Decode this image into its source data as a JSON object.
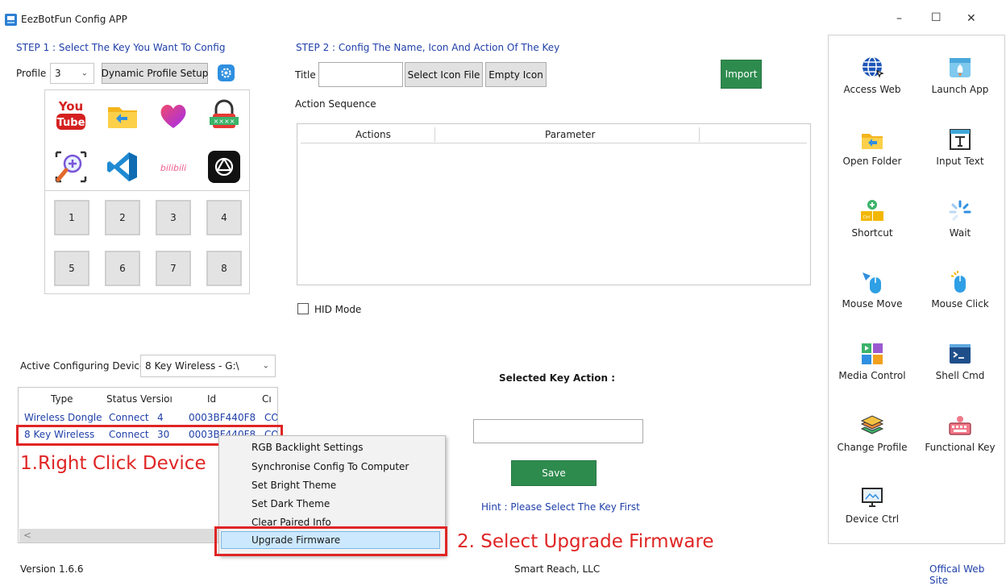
{
  "window": {
    "title": "EezBotFun Config APP",
    "controls": {
      "minimize": "–",
      "maximize": "☐",
      "close": "✕"
    }
  },
  "step1": {
    "title": "STEP 1 : Select The Key You Want To Config",
    "profile_label": "Profile",
    "profile_value": "3",
    "dynamic_button": "Dynamic Profile Setup",
    "app_keys": [
      {
        "icon": "youtube-icon",
        "youtube_text_top": "You",
        "youtube_text_bottom": "Tube"
      },
      {
        "icon": "folder-icon"
      },
      {
        "icon": "heart-icon"
      },
      {
        "icon": "password-lock-icon"
      },
      {
        "icon": "magnifier-icon"
      },
      {
        "icon": "vscode-icon"
      },
      {
        "icon": "bilibili-icon",
        "text": "bilibili"
      },
      {
        "icon": "openai-icon"
      }
    ],
    "num_keys": [
      "1",
      "2",
      "3",
      "4",
      "5",
      "6",
      "7",
      "8"
    ]
  },
  "step2": {
    "title": "STEP 2 : Config The Name, Icon And Action Of The Key",
    "title_label": "Title",
    "title_value": "",
    "select_icon_button": "Select Icon File",
    "empty_icon_button": "Empty Icon",
    "import_button": "Import",
    "action_sequence_label": "Action Sequence",
    "table_headers": [
      "Actions",
      "Parameter"
    ],
    "hid_mode_label": "HID Mode",
    "hid_mode_checked": false
  },
  "device": {
    "label": "Active Configuring Device",
    "selected": "8 Key Wireless - G:\\",
    "columns": [
      "Type",
      "Status",
      "Versioı",
      "Id",
      "Cı"
    ],
    "rows": [
      {
        "type": "Wireless Dongle",
        "status": "Connect",
        "version": "4",
        "id": "0003BF440F8",
        "c": "CO"
      },
      {
        "type": "8 Key Wireless",
        "status": "Connect",
        "version": "30",
        "id": "0003BF440F8",
        "c": "CO"
      }
    ],
    "scroll_left": "<"
  },
  "context_menu": {
    "items": [
      "RGB Backlight Settings",
      "Synchronise Config To Computer",
      "Set Bright Theme",
      "Set Dark Theme",
      "Clear Paired Info",
      "Upgrade Firmware"
    ],
    "highlighted_index": 5
  },
  "annotations": {
    "right_click": "1.Right Click Device",
    "select_upgrade": "2. Select Upgrade Firmware",
    "color": "#e02525"
  },
  "selected_key": {
    "label": "Selected Key Action :",
    "value": "",
    "save_button": "Save",
    "hint": "Hint : Please Select The Key First"
  },
  "sidebar": {
    "items": [
      {
        "label": "Access Web",
        "icon": "globe-icon"
      },
      {
        "label": "Launch App",
        "icon": "rocket-icon"
      },
      {
        "label": "Open Folder",
        "icon": "folder-icon"
      },
      {
        "label": "Input Text",
        "icon": "text-input-icon"
      },
      {
        "label": "Shortcut",
        "icon": "shortcut-icon"
      },
      {
        "label": "Wait",
        "icon": "spinner-icon"
      },
      {
        "label": "Mouse Move",
        "icon": "mouse-move-icon"
      },
      {
        "label": "Mouse Click",
        "icon": "mouse-click-icon"
      },
      {
        "label": "Media Control",
        "icon": "media-control-icon"
      },
      {
        "label": "Shell Cmd",
        "icon": "terminal-icon"
      },
      {
        "label": "Change Profile",
        "icon": "layers-icon"
      },
      {
        "label": "Functional Key",
        "icon": "keyboard-icon"
      },
      {
        "label": "Device Ctrl",
        "icon": "monitor-icon"
      }
    ]
  },
  "footer": {
    "version": "Version 1.6.6",
    "company": "Smart Reach, LLC",
    "website": "Offical Web Site"
  },
  "colors": {
    "accent_blue": "#1f3fa8",
    "save_green": "#2e8b4e",
    "annotation_red": "#e02525",
    "highlight_blue": "#cce8ff"
  }
}
